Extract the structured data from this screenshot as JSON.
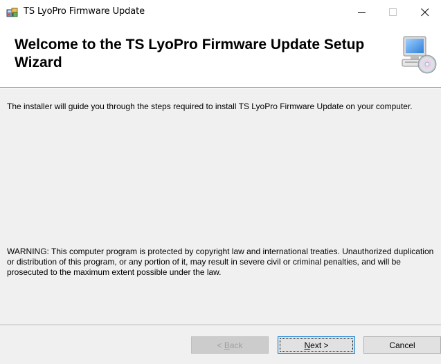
{
  "window": {
    "title": "TS LyoPro Firmware Update",
    "icon": "installer-icon",
    "controls": {
      "minimize_glyph": "—",
      "maximize_glyph": "☐",
      "close_glyph": "✕"
    }
  },
  "header": {
    "title": "Welcome to the TS LyoPro Firmware Update Setup Wizard",
    "icon": "computer-cd-icon"
  },
  "body": {
    "intro": "The installer will guide you through the steps required to install TS LyoPro Firmware Update on your computer.",
    "warning": "WARNING: This computer program is protected by copyright law and international treaties. Unauthorized duplication or distribution of this program, or any portion of it, may result in severe civil or criminal penalties, and will be prosecuted to the maximum extent possible under the law."
  },
  "buttons": {
    "back": {
      "prefix": "< ",
      "accel": "B",
      "rest": "ack",
      "enabled": false
    },
    "next": {
      "accel": "N",
      "rest": "ext >",
      "enabled": true,
      "focused": true
    },
    "cancel": {
      "label": "Cancel",
      "enabled": true
    }
  },
  "colors": {
    "focus_border": "#0078d7",
    "disabled_text": "#a0a0a0"
  }
}
